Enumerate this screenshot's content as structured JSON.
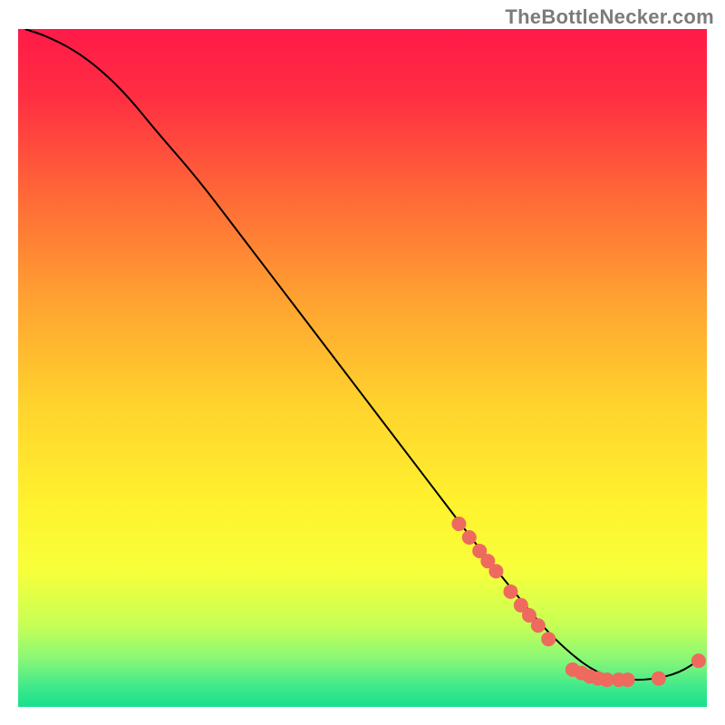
{
  "attribution": "TheBottleNecker.com",
  "chart_data": {
    "type": "line",
    "title": "",
    "xlabel": "",
    "ylabel": "",
    "xlim": [
      0,
      100
    ],
    "ylim": [
      0,
      100
    ],
    "background_gradient": {
      "stops": [
        {
          "offset": 0.0,
          "color": "#ff1a48"
        },
        {
          "offset": 0.1,
          "color": "#ff2e42"
        },
        {
          "offset": 0.25,
          "color": "#ff6a37"
        },
        {
          "offset": 0.4,
          "color": "#ffa231"
        },
        {
          "offset": 0.55,
          "color": "#ffd22d"
        },
        {
          "offset": 0.7,
          "color": "#fff22e"
        },
        {
          "offset": 0.8,
          "color": "#f7ff3a"
        },
        {
          "offset": 0.88,
          "color": "#c6ff55"
        },
        {
          "offset": 0.93,
          "color": "#88f777"
        },
        {
          "offset": 0.97,
          "color": "#40e98b"
        },
        {
          "offset": 1.0,
          "color": "#17df8c"
        }
      ]
    },
    "series": [
      {
        "name": "curve",
        "stroke": "#000000",
        "x": [
          1,
          4,
          8,
          12,
          16,
          20,
          26,
          32,
          38,
          44,
          50,
          56,
          62,
          68,
          72,
          76,
          80,
          84,
          88,
          92,
          96,
          99
        ],
        "y": [
          100,
          99,
          97,
          94,
          90,
          85,
          78,
          70,
          62,
          54,
          46,
          38,
          30,
          22,
          17,
          12,
          8,
          5,
          4,
          4,
          5,
          7
        ]
      }
    ],
    "markers": {
      "color": "#ee6a5e",
      "radius": 8,
      "points": [
        {
          "x": 64.0,
          "y": 27
        },
        {
          "x": 65.5,
          "y": 25
        },
        {
          "x": 67.0,
          "y": 23
        },
        {
          "x": 68.2,
          "y": 21.5
        },
        {
          "x": 69.4,
          "y": 20
        },
        {
          "x": 71.5,
          "y": 17
        },
        {
          "x": 73.0,
          "y": 15
        },
        {
          "x": 74.2,
          "y": 13.5
        },
        {
          "x": 75.5,
          "y": 12
        },
        {
          "x": 77.0,
          "y": 10
        },
        {
          "x": 80.5,
          "y": 5.5
        },
        {
          "x": 81.8,
          "y": 5.0
        },
        {
          "x": 83.0,
          "y": 4.5
        },
        {
          "x": 84.2,
          "y": 4.2
        },
        {
          "x": 85.5,
          "y": 4.0
        },
        {
          "x": 87.2,
          "y": 4.0
        },
        {
          "x": 88.5,
          "y": 4.0
        },
        {
          "x": 93.0,
          "y": 4.2
        },
        {
          "x": 98.8,
          "y": 6.8
        }
      ]
    }
  }
}
